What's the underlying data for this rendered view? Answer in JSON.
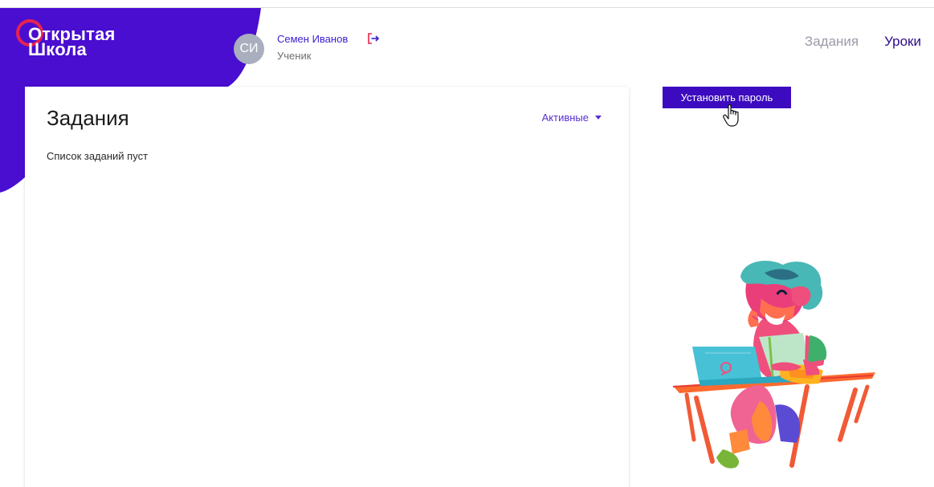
{
  "logo": {
    "line1": "Открытая",
    "line2": "Школа"
  },
  "user": {
    "initials": "СИ",
    "name": "Семен Иванов",
    "role": "Ученик"
  },
  "nav": {
    "tasks": "Задания",
    "lessons": "Уроки"
  },
  "tasks_card": {
    "title": "Задания",
    "filter_label": "Активные",
    "empty_message": "Список заданий пуст"
  },
  "actions": {
    "set_password": "Установить пароль"
  },
  "colors": {
    "brand_purple": "#4a0ed1",
    "logo_ring": "#e8234f",
    "button": "#3c0bbf",
    "link": "#5a2fd0",
    "avatar": "#a9afbe"
  },
  "icons": {
    "logout": "logout-icon",
    "dropdown": "caret-down-icon",
    "cursor": "hand-cursor-icon"
  }
}
